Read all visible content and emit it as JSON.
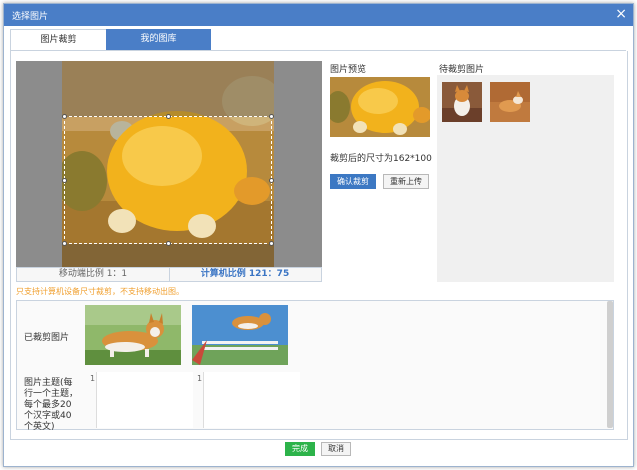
{
  "window": {
    "title": "选择图片"
  },
  "tabs": [
    {
      "label": "图片裁剪"
    },
    {
      "label": "我的图库"
    }
  ],
  "crop": {
    "ratio_left": "移动端比例 1：1",
    "ratio_right": "计算机比例 121：75",
    "warning": "只支持计算机设备尺寸裁剪，不支持移动出图。"
  },
  "preview": {
    "label": "图片预览",
    "size_text": "裁剪后的尺寸为162*100",
    "confirm_label": "确认裁剪",
    "reupload_label": "重新上传"
  },
  "pending": {
    "label": "待裁剪图片"
  },
  "bottom": {
    "cropped_label": "已裁剪图片",
    "theme_label": "图片主题(每行一个主题，每个最多20个汉字或40个英文)",
    "line_numbers": [
      "1",
      "1"
    ]
  },
  "footer": {
    "done_label": "完成",
    "cancel_label": "取消"
  },
  "colors": {
    "titlebar": "#4a7ec7",
    "confirm": "#3c78c3",
    "done": "#2db34a",
    "warning": "#f0a030"
  },
  "icons": {
    "close": "close-icon"
  }
}
